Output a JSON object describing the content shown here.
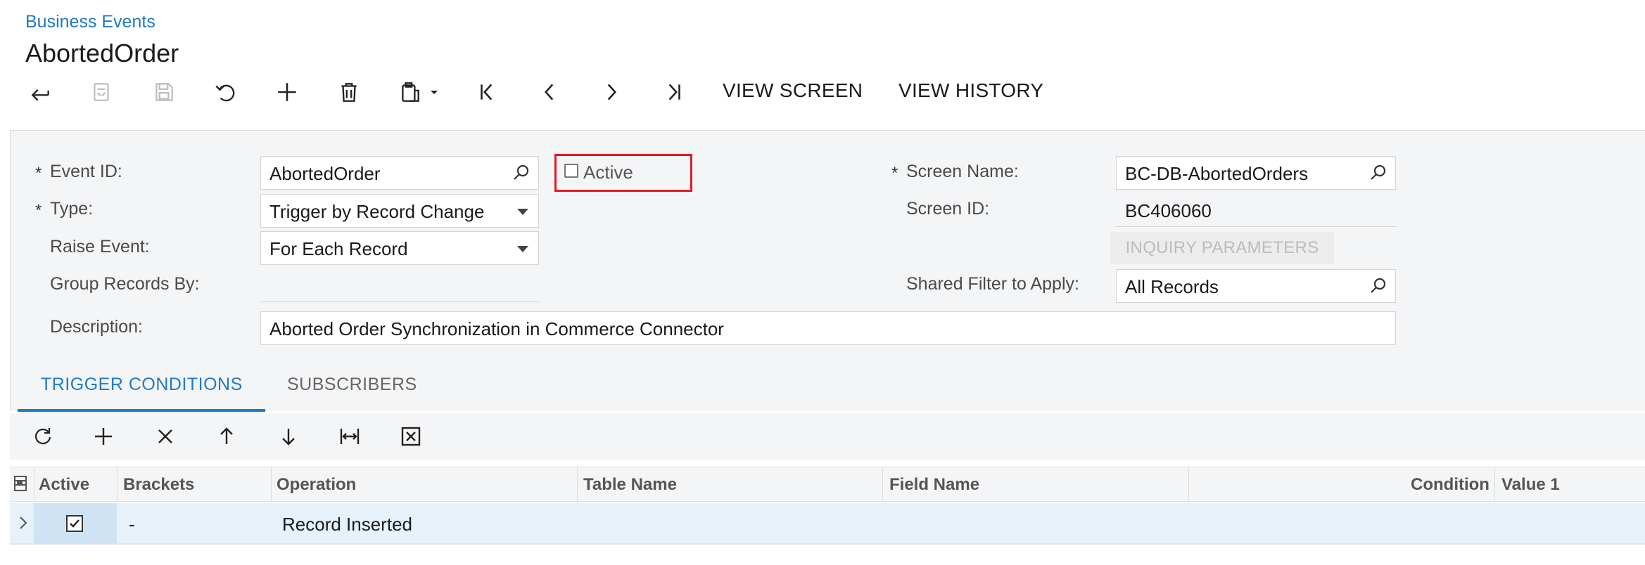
{
  "header": {
    "breadcrumb": "Business Events",
    "title": "AbortedOrder"
  },
  "toolbar": {
    "icons": [
      "back-icon",
      "revert-icon",
      "save-icon",
      "undo-icon",
      "add-icon",
      "delete-icon",
      "clipboard-icon",
      "first-record-icon",
      "prev-record-icon",
      "next-record-icon",
      "last-record-icon"
    ],
    "view_screen": "VIEW SCREEN",
    "view_history": "VIEW HISTORY"
  },
  "form": {
    "required_mark": "*",
    "event_id_label": "Event ID:",
    "event_id_value": "AbortedOrder",
    "active_label": "Active",
    "active_checked": false,
    "type_label": "Type:",
    "type_value": "Trigger by Record Change",
    "raise_event_label": "Raise Event:",
    "raise_event_value": "For Each Record",
    "group_records_label": "Group Records By:",
    "group_records_value": "",
    "description_label": "Description:",
    "description_value": "Aborted Order Synchronization in Commerce Connector",
    "screen_name_label": "Screen Name:",
    "screen_name_value": "BC-DB-AbortedOrders",
    "screen_id_label": "Screen ID:",
    "screen_id_value": "BC406060",
    "inquiry_button": "INQUIRY PARAMETERS",
    "shared_filter_label": "Shared Filter to Apply:",
    "shared_filter_value": "All Records"
  },
  "tabs": [
    {
      "label": "TRIGGER CONDITIONS",
      "active": true
    },
    {
      "label": "SUBSCRIBERS",
      "active": false
    }
  ],
  "grid_toolbar": {
    "icons": [
      "refresh-icon",
      "add-row-icon",
      "delete-row-icon",
      "move-up-icon",
      "move-down-icon",
      "fit-columns-icon",
      "export-excel-icon"
    ]
  },
  "grid": {
    "columns": [
      "Active",
      "Brackets",
      "Operation",
      "Table Name",
      "Field Name",
      "Condition",
      "Value 1"
    ],
    "rows": [
      {
        "active": true,
        "brackets": "-",
        "operation": "Record Inserted",
        "table_name": "",
        "field_name": "",
        "condition": "",
        "value1": ""
      }
    ]
  },
  "colors": {
    "accent": "#1f7ac4",
    "highlight_border": "#e01b24",
    "selected_row": "#e6f1fa"
  }
}
